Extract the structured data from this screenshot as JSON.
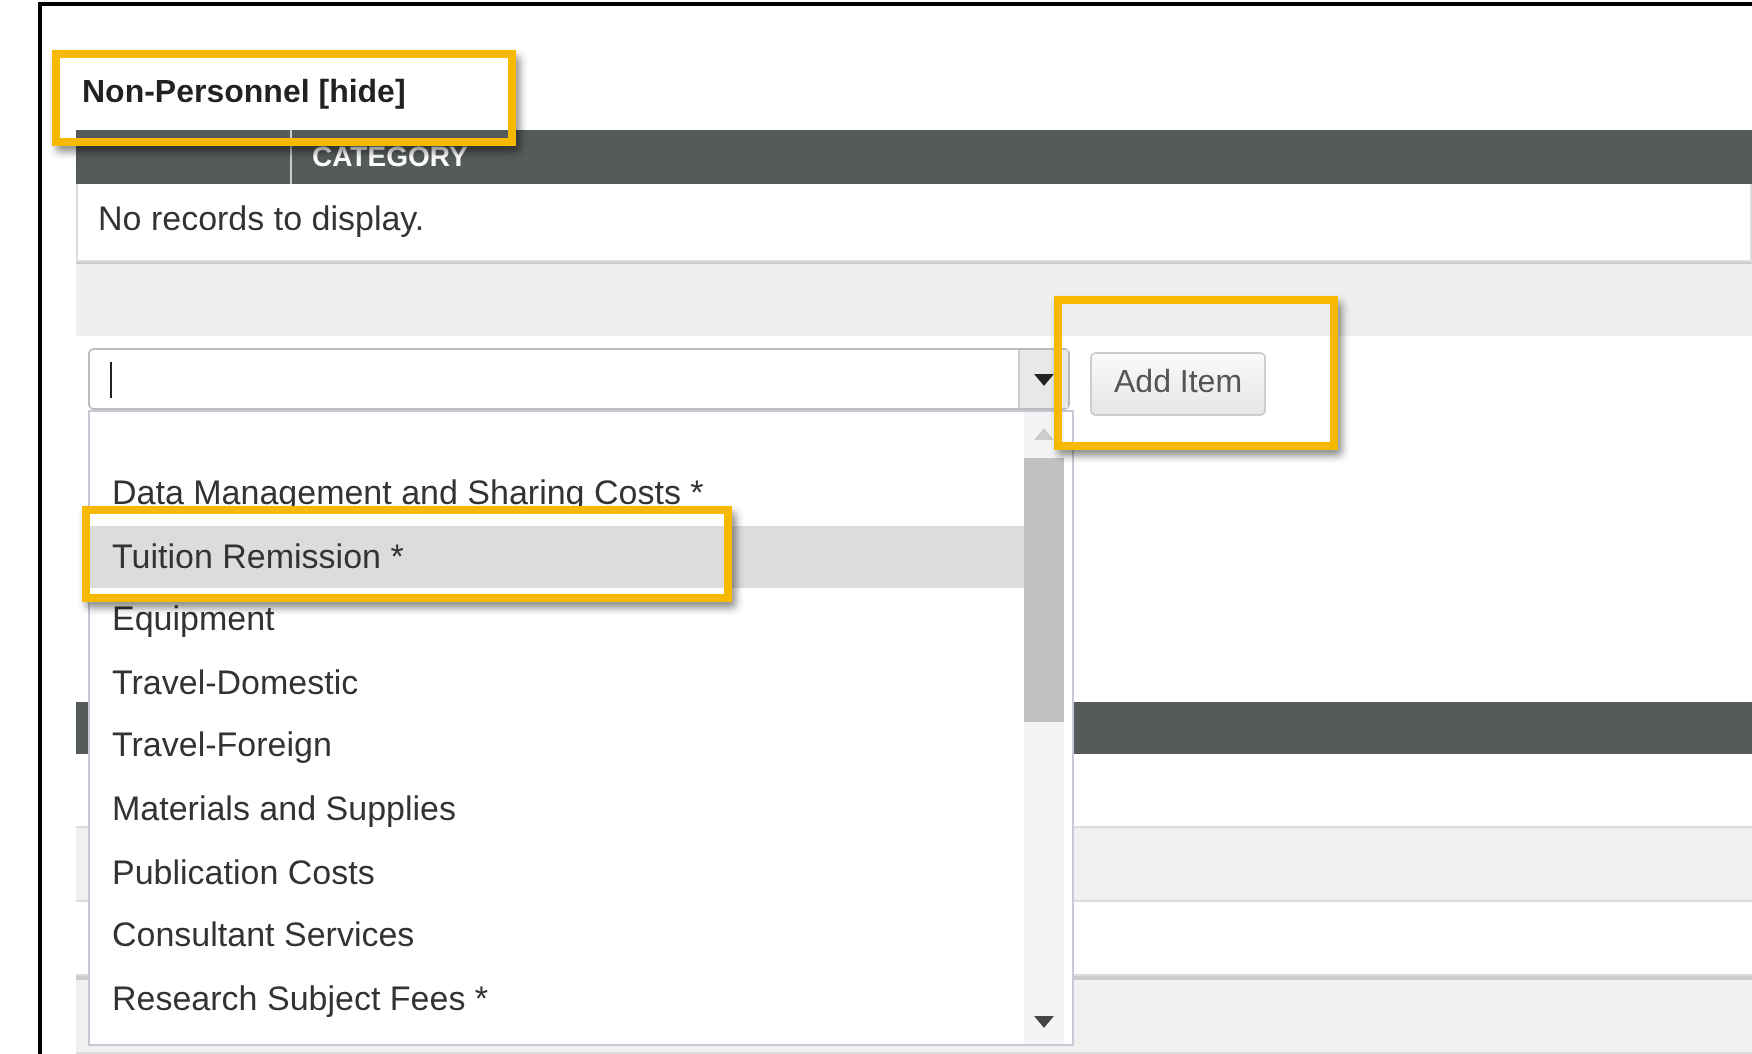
{
  "section": {
    "title": "Non-Personnel [hide]",
    "highlighted": true
  },
  "table": {
    "columns": [
      "",
      "CATEGORY"
    ],
    "empty_text": "No records to display."
  },
  "combobox": {
    "open": true
  },
  "add_button": {
    "label": "Add Item",
    "highlighted": true
  },
  "dropdown": {
    "items": [
      {
        "label": "Data Management and Sharing Costs *",
        "selected": false,
        "highlighted": false
      },
      {
        "label": "Tuition Remission *",
        "selected": true,
        "highlighted": true
      },
      {
        "label": "Equipment",
        "selected": false,
        "highlighted": false
      },
      {
        "label": "Travel-Domestic",
        "selected": false,
        "highlighted": false
      },
      {
        "label": "Travel-Foreign",
        "selected": false,
        "highlighted": false
      },
      {
        "label": "Materials and Supplies",
        "selected": false,
        "highlighted": false
      },
      {
        "label": "Publication Costs",
        "selected": false,
        "highlighted": false
      },
      {
        "label": "Consultant Services",
        "selected": false,
        "highlighted": false
      },
      {
        "label": "Research Subject Fees *",
        "selected": false,
        "highlighted": false
      }
    ]
  }
}
